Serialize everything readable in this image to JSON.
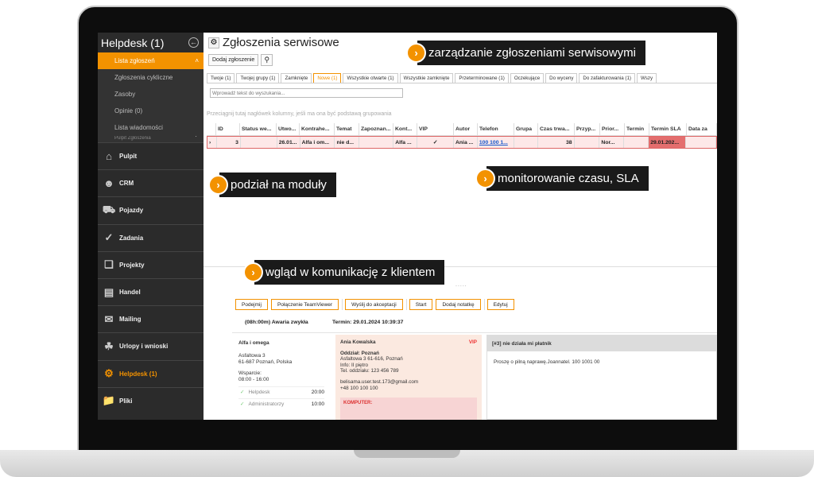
{
  "sidebar": {
    "title": "Helpdesk (1)",
    "back_icon": "circle-arrow-left-icon",
    "submenu": [
      {
        "label": "Lista zgłoszeń",
        "active": true
      },
      {
        "label": "Zgłoszenia cykliczne",
        "active": false
      },
      {
        "label": "Zasoby",
        "active": false
      },
      {
        "label": "Opinie (0)",
        "active": false
      },
      {
        "label": "Lista wiadomości",
        "active": false
      }
    ],
    "submenu_more": "Pulpit Zgłoszenia",
    "modules": [
      {
        "label": "Pulpit",
        "icon": "home-icon"
      },
      {
        "label": "CRM",
        "icon": "people-icon"
      },
      {
        "label": "Pojazdy",
        "icon": "car-icon"
      },
      {
        "label": "Zadania",
        "icon": "check-icon"
      },
      {
        "label": "Projekty",
        "icon": "cubes-icon"
      },
      {
        "label": "Handel",
        "icon": "document-icon"
      },
      {
        "label": "Mailing",
        "icon": "envelope-icon"
      },
      {
        "label": "Urlopy i wnioski",
        "icon": "palm-tree-icon"
      },
      {
        "label": "Helpdesk (1)",
        "icon": "gear-icon",
        "active": true
      },
      {
        "label": "Pliki",
        "icon": "folder-icon"
      }
    ]
  },
  "header": {
    "title": "Zgłoszenia serwisowe",
    "add_button": "Dodaj zgłoszenie"
  },
  "tabs": [
    {
      "label": "Twoje (1)",
      "active": false
    },
    {
      "label": "Twojej grupy (1)",
      "active": false
    },
    {
      "label": "Zamknięte",
      "active": false
    },
    {
      "label": "Nowe (1)",
      "active": true
    },
    {
      "label": "Wszystkie otwarte (1)",
      "active": false
    },
    {
      "label": "Wszystkie zamknięte",
      "active": false
    },
    {
      "label": "Przeterminowane (1)",
      "active": false
    },
    {
      "label": "Oczekujące",
      "active": false
    },
    {
      "label": "Do wyceny",
      "active": false
    },
    {
      "label": "Do zafakturowania (1)",
      "active": false
    },
    {
      "label": "Wszy",
      "active": false
    }
  ],
  "search": {
    "placeholder": "Wprowadź tekst do wyszukania..."
  },
  "grid": {
    "group_hint": "Przeciągnij tutaj nagłówek kolumny, jeśli ma ona być podstawą grupowania",
    "columns": [
      "",
      "ID",
      "Status we...",
      "Utwo...",
      "Kontrahe...",
      "Temat",
      "Zapoznan...",
      "Kont...",
      "VIP",
      "Autor",
      "Telefon",
      "Grupa",
      "Czas trwa...",
      "Przyp...",
      "Prior...",
      "Termin",
      "Termin SLA",
      "Data za"
    ],
    "row": [
      "›",
      "3",
      "",
      "26.01...",
      "Alfa i om...",
      "nie d...",
      "",
      "Alfa ...",
      "✓",
      "Ania ...",
      "100 100 1...",
      "",
      "38",
      "",
      "Nor...",
      "",
      "29.01.202...",
      ""
    ]
  },
  "details": {
    "buttons": [
      "Podejmij",
      "Połączenie TeamViewer",
      "Wyślij do akceptacji",
      "Start",
      "Dodaj notatkę",
      "Edytuj"
    ],
    "alarm": "(08h:00m) Awaria zwykła",
    "term": "Termin: 29.01.2024 10:39:37",
    "client": {
      "name": "Alfa i omega",
      "address1": "Asfaltowa 3",
      "address2": "61-687 Poznań, Polska",
      "support_label": "Wsparcie:",
      "support_hours": "08:00 - 16:00",
      "rows": [
        {
          "label": "Helpdesk",
          "time": "20:00"
        },
        {
          "label": "Administratorzy",
          "time": "10:00"
        }
      ]
    },
    "contact": {
      "name": "Ania Kowalska",
      "vip": "VIP",
      "branch": "Oddział: Poznań",
      "address": "Asfaltowa 3 61-616, Poznań",
      "info": "Info: II piętro",
      "phone_branch": "Tel. oddziału: 123 456 789",
      "email": "belisama.user.test.173@gmail.com",
      "phone": "+48 100 100 100",
      "computer": "KOMPUTER:"
    },
    "message": {
      "title": "[#3] nie działa mi płatnik",
      "body": "Proszę o pilną naprawę.Joannatel. 100 1001 00"
    }
  },
  "callouts": [
    "zarządzanie zgłoszeniami serwisowymi",
    "podział na moduły",
    "monitorowanie czasu, SLA",
    "wgląd w komunikację z klientem"
  ],
  "colors": {
    "accent": "#f39200",
    "sidebar": "#2b2b2b",
    "sla_overdue": "#e46e6e"
  }
}
